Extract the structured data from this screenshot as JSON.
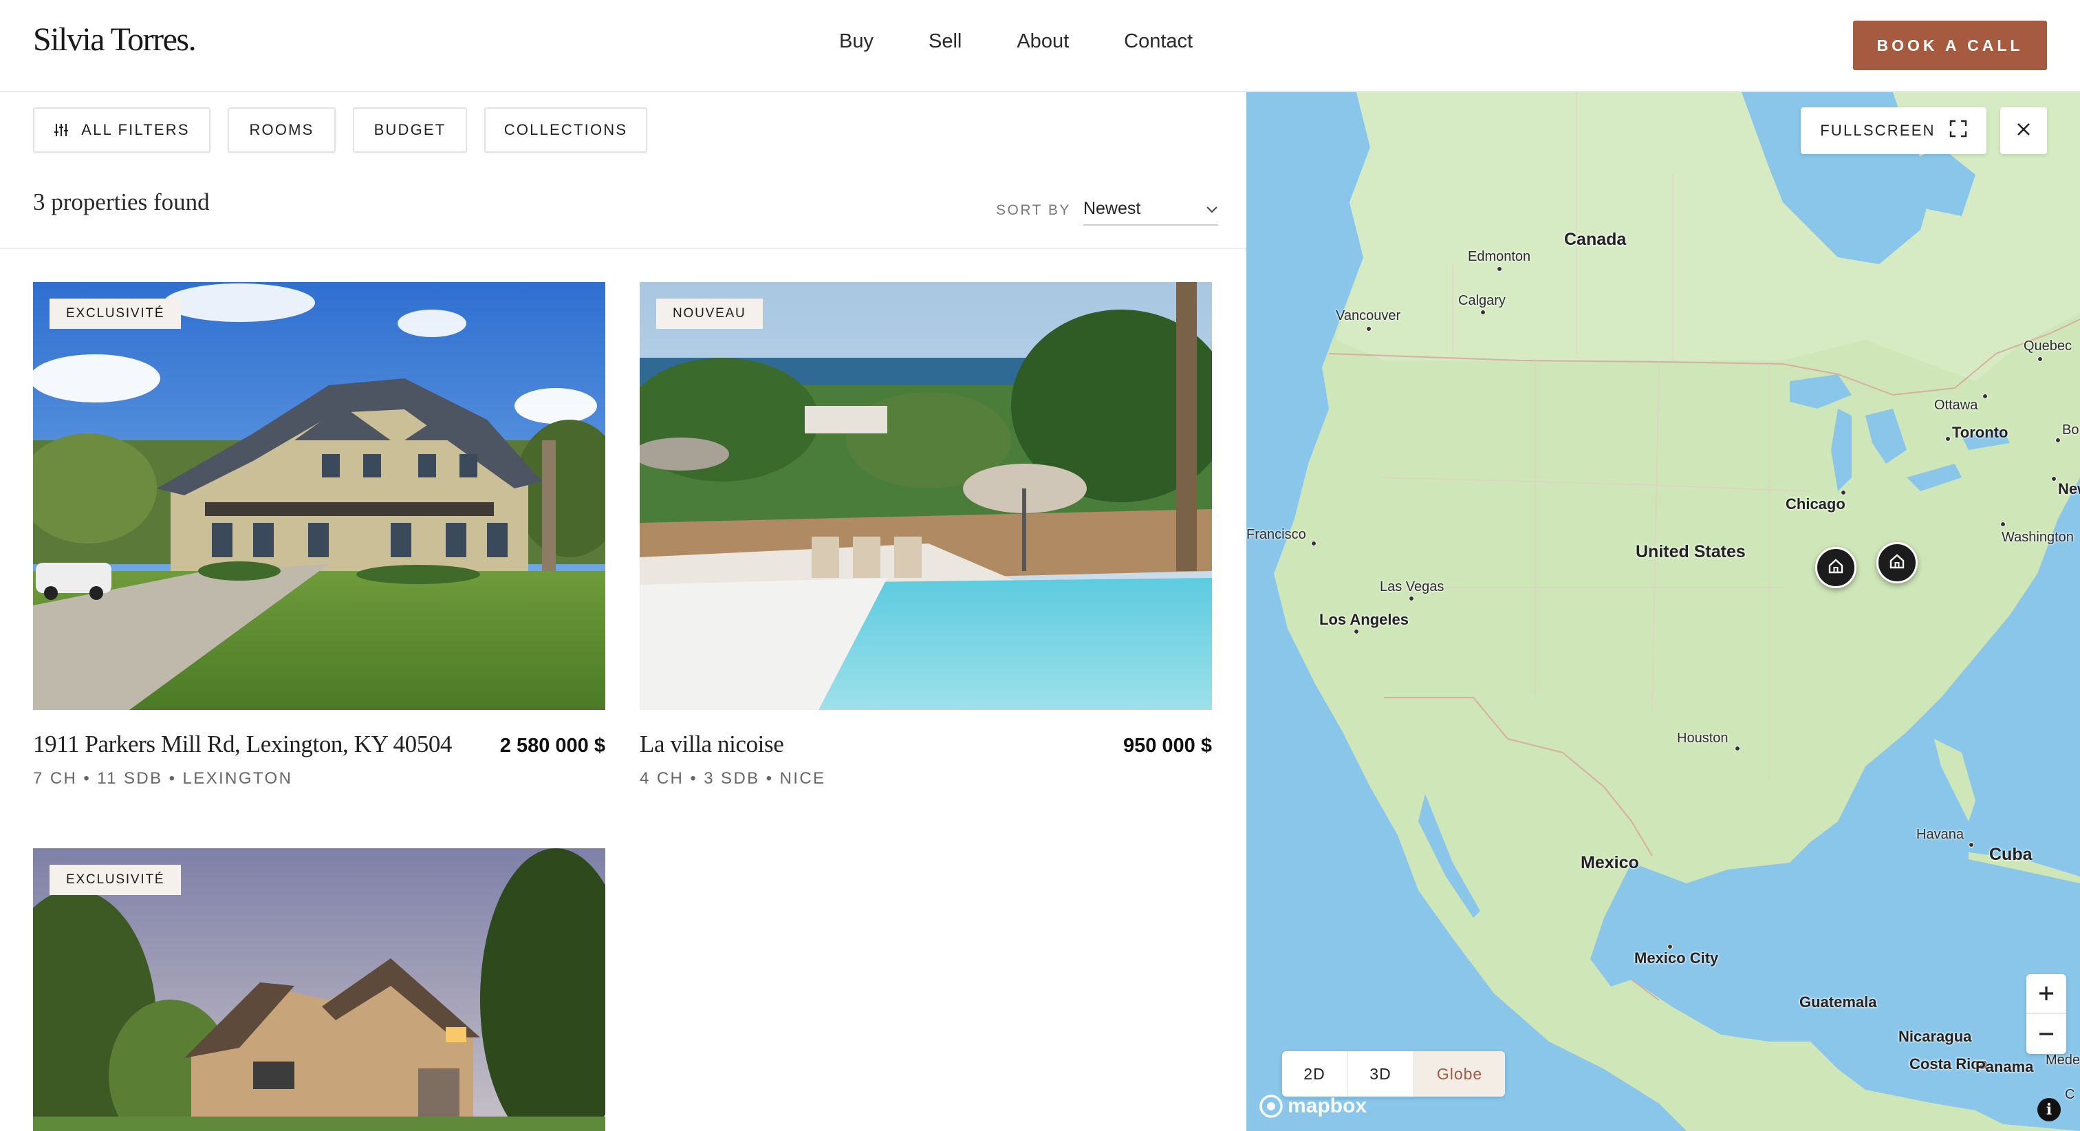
{
  "brand": {
    "name": "Silvia Torres."
  },
  "nav": {
    "items": [
      "Buy",
      "Sell",
      "About",
      "Contact"
    ]
  },
  "header": {
    "cta_label": "BOOK A CALL"
  },
  "filters": {
    "all": "ALL FILTERS",
    "rooms": "ROOMS",
    "budget": "BUDGET",
    "collections": "COLLECTIONS"
  },
  "results": {
    "count_text": "3 properties found"
  },
  "sort": {
    "label": "SORT BY",
    "value": "Newest"
  },
  "listings": [
    {
      "badge": "EXCLUSIVITÉ",
      "address": "1911 Parkers Mill Rd, Lexington, KY 40504",
      "price": "2 580 000 $",
      "meta": "7 CH • 11 SDB • LEXINGTON"
    },
    {
      "badge": "NOUVEAU",
      "address": "La villa nicoise",
      "price": "950 000 $",
      "meta": "4 CH • 3 SDB • NICE"
    },
    {
      "badge": "EXCLUSIVITÉ",
      "address": "",
      "price": "",
      "meta": ""
    }
  ],
  "map": {
    "fullscreen_label": "FULLSCREEN",
    "modes": [
      "2D",
      "3D",
      "Globe"
    ],
    "active_mode": "Globe",
    "attribution": "mapbox",
    "labels": {
      "canada": "Canada",
      "edmonton": "Edmonton",
      "calgary": "Calgary",
      "vancouver": "Vancouver",
      "quebec": "Quebec",
      "ottawa": "Ottawa",
      "toronto": "Toronto",
      "bo": "Bo",
      "chicago": "Chicago",
      "new_york": "New Y",
      "washington": "Washington",
      "francisco": "Francisco",
      "united_states": "United States",
      "las_vegas": "Las Vegas",
      "los_angeles": "Los Angeles",
      "houston": "Houston",
      "havana": "Havana",
      "cuba": "Cuba",
      "mexico": "Mexico",
      "mexico_city": "Mexico City",
      "guatemala": "Guatemala",
      "nicaragua": "Nicaragua",
      "costa_rica": "Costa Rica",
      "panama": "Panama",
      "mede": "Mede",
      "c": "C"
    }
  },
  "colors": {
    "accent": "#a65a3f",
    "water": "#89c6ea",
    "land": "#cfe6b8"
  }
}
